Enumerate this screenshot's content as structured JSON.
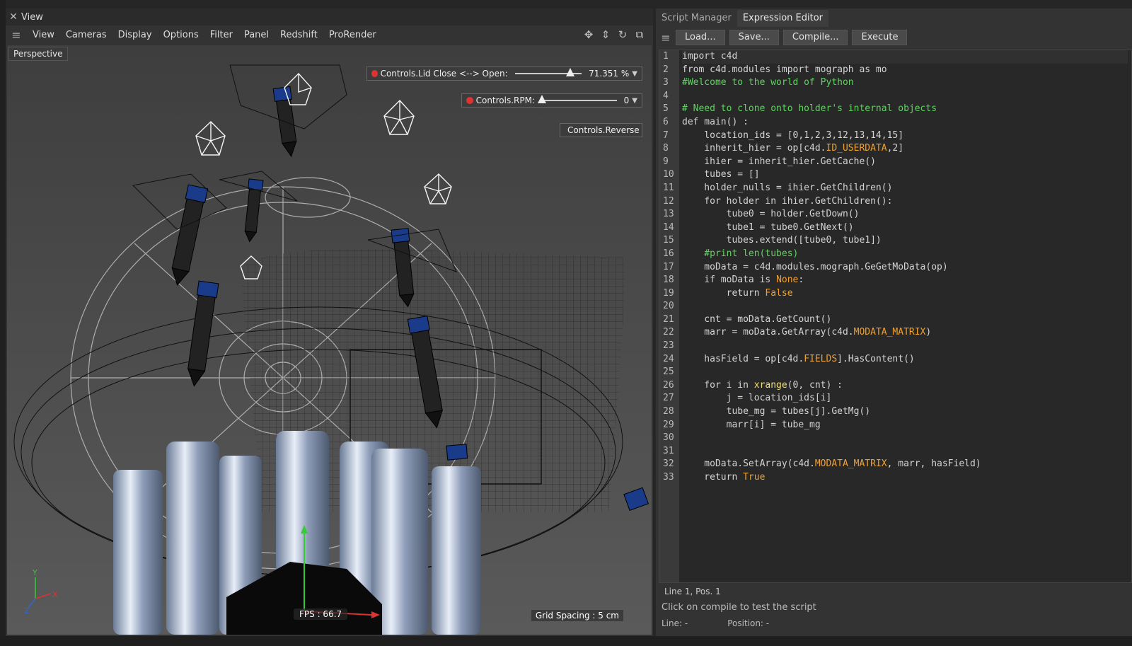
{
  "viewport": {
    "window_title": "View",
    "menu": [
      "View",
      "Cameras",
      "Display",
      "Options",
      "Filter",
      "Panel",
      "Redshift",
      "ProRender"
    ],
    "camera_label": "Perspective",
    "hud": {
      "lid": {
        "label": "Controls.Lid Close <--> Open:",
        "value": "71.351 %",
        "fraction": 0.71351
      },
      "rpm": {
        "label": "Controls.RPM:",
        "value": "0",
        "fraction": 0.0
      },
      "reverse": {
        "label": "Controls.Reverse"
      }
    },
    "fps": "FPS : 66.7",
    "grid_spacing": "Grid Spacing : 5 cm",
    "axis": {
      "x": "X",
      "y": "Y",
      "z": "Z"
    }
  },
  "editor": {
    "tabs": [
      "Script Manager",
      "Expression Editor"
    ],
    "active_tab": "Expression Editor",
    "buttons": {
      "load": "Load...",
      "save": "Save...",
      "compile": "Compile...",
      "execute": "Execute"
    },
    "status_position": "Line 1, Pos. 1",
    "status_message": "Click on compile to test the script",
    "line_label": "Line: -",
    "position_label": "Position: -",
    "lines": [
      "import c4d",
      "from c4d.modules import mograph as mo",
      "#Welcome to the world of Python",
      "",
      "# Need to clone onto holder's internal objects",
      "def main() :",
      "    location_ids = [0,1,2,3,12,13,14,15]",
      "    inherit_hier = op[c4d.ID_USERDATA,2]",
      "    ihier = inherit_hier.GetCache()",
      "    tubes = []",
      "    holder_nulls = ihier.GetChildren()",
      "    for holder in ihier.GetChildren():",
      "        tube0 = holder.GetDown()",
      "        tube1 = tube0.GetNext()",
      "        tubes.extend([tube0, tube1])",
      "    #print len(tubes)",
      "    moData = c4d.modules.mograph.GeGetMoData(op)",
      "    if moData is None:",
      "        return False",
      "",
      "    cnt = moData.GetCount()",
      "    marr = moData.GetArray(c4d.MODATA_MATRIX)",
      "",
      "    hasField = op[c4d.FIELDS].HasContent()",
      "",
      "    for i in xrange(0, cnt) :",
      "        j = location_ids[i]",
      "        tube_mg = tubes[j].GetMg()",
      "        marr[i] = tube_mg",
      "",
      "",
      "    moData.SetArray(c4d.MODATA_MATRIX, marr, hasField)",
      "    return True"
    ]
  }
}
